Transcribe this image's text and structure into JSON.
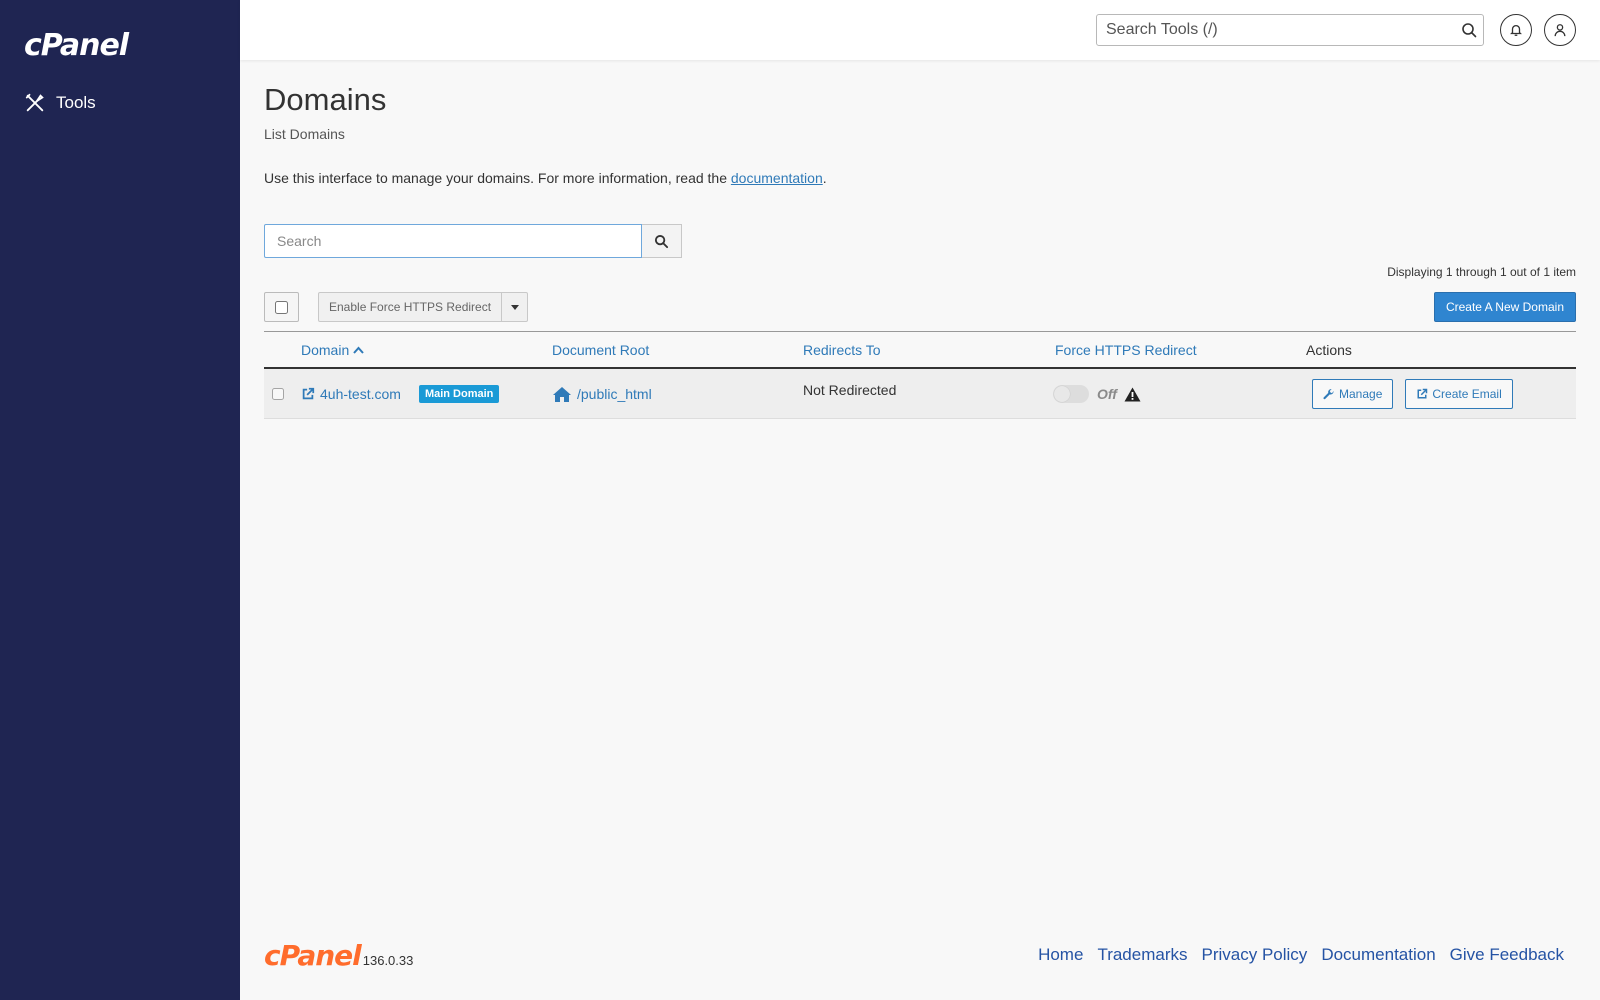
{
  "sidebar": {
    "logo": "cPanel",
    "nav": [
      {
        "label": "Tools"
      }
    ]
  },
  "header": {
    "search_placeholder": "Search Tools (/)"
  },
  "page": {
    "title": "Domains",
    "subtitle": "List Domains",
    "intro_text": "Use this interface to manage your domains. For more information, read the",
    "intro_link": "documentation",
    "intro_end": ".",
    "search_placeholder": "Search",
    "display_count": "Displaying 1 through 1 out of 1 item",
    "bulk_action_label": "Enable Force HTTPS Redirect",
    "create_button": "Create A New Domain"
  },
  "table": {
    "columns": [
      "Domain",
      "Document Root",
      "Redirects To",
      "Force HTTPS Redirect",
      "Actions"
    ],
    "rows": [
      {
        "domain": "4uh-test.com",
        "badge": "Main Domain",
        "document_root": "/public_html",
        "redirects_to": "Not Redirected",
        "force_https": "Off",
        "actions": [
          "Manage",
          "Create Email"
        ]
      }
    ]
  },
  "footer": {
    "logo": "cPanel",
    "version": "136.0.33",
    "links": [
      "Home",
      "Trademarks",
      "Privacy Policy",
      "Documentation",
      "Give Feedback"
    ]
  },
  "colors": {
    "sidebar_bg": "#1f2552",
    "link": "#2f7ab8",
    "primary_button": "#2f85d0",
    "badge": "#1a9ad6",
    "footer_logo": "#ff6c2c"
  }
}
